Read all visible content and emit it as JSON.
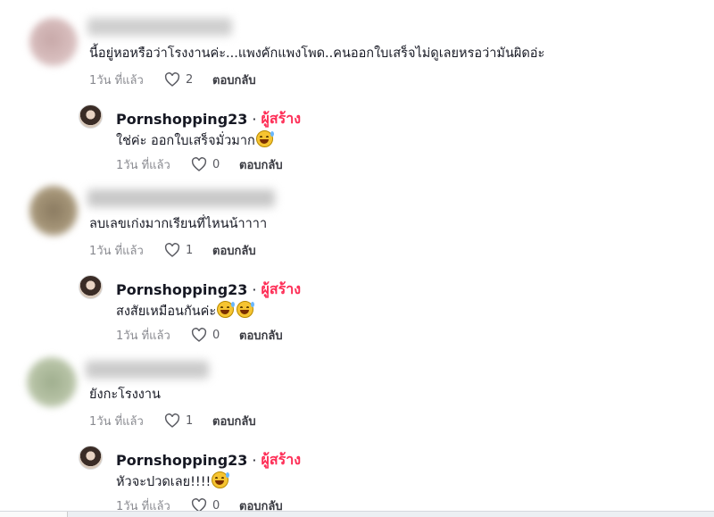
{
  "threads": [
    {
      "comment": {
        "text": "นี้อยู่หอหรือว่าโรงงานค่ะ...แพงคักแพงโพด..คนออกใบเสร็จไม่ดูเลยหรอว่ามันผิดอ่ะ",
        "time": "1วัน ที่แล้ว",
        "likes": "2",
        "reply": "ตอบกลับ"
      },
      "reply": {
        "username": "Pornshopping23",
        "separator": "·",
        "creator_badge": "ผู้สร้าง",
        "text": "ใช่ค่ะ ออกใบเสร็จมั่วมาก",
        "emoji_count": 1,
        "time": "1วัน ที่แล้ว",
        "likes": "0",
        "reply": "ตอบกลับ"
      }
    },
    {
      "comment": {
        "text": "ลบเลขเก่งมากเรียนที่ไหนน้าาาา",
        "time": "1วัน ที่แล้ว",
        "likes": "1",
        "reply": "ตอบกลับ"
      },
      "reply": {
        "username": "Pornshopping23",
        "separator": "·",
        "creator_badge": "ผู้สร้าง",
        "text": "สงสัยเหมือนกันค่ะ",
        "emoji_count": 2,
        "time": "1วัน ที่แล้ว",
        "likes": "0",
        "reply": "ตอบกลับ"
      }
    },
    {
      "comment": {
        "text": "ยังกะโรงงาน",
        "time": "1วัน ที่แล้ว",
        "likes": "1",
        "reply": "ตอบกลับ"
      },
      "reply": {
        "username": "Pornshopping23",
        "separator": "·",
        "creator_badge": "ผู้สร้าง",
        "text": "หัวจะปวดเลย!!!!",
        "emoji_count": 1,
        "time": "1วัน ที่แล้ว",
        "likes": "0",
        "reply": "ตอบกลับ"
      }
    }
  ],
  "icons": {
    "like": "heart-outline-icon",
    "emoji": "grinning-sweat-emoji-icon"
  },
  "colors": {
    "creator": "#fe2c55",
    "time": "#8a8b91"
  }
}
